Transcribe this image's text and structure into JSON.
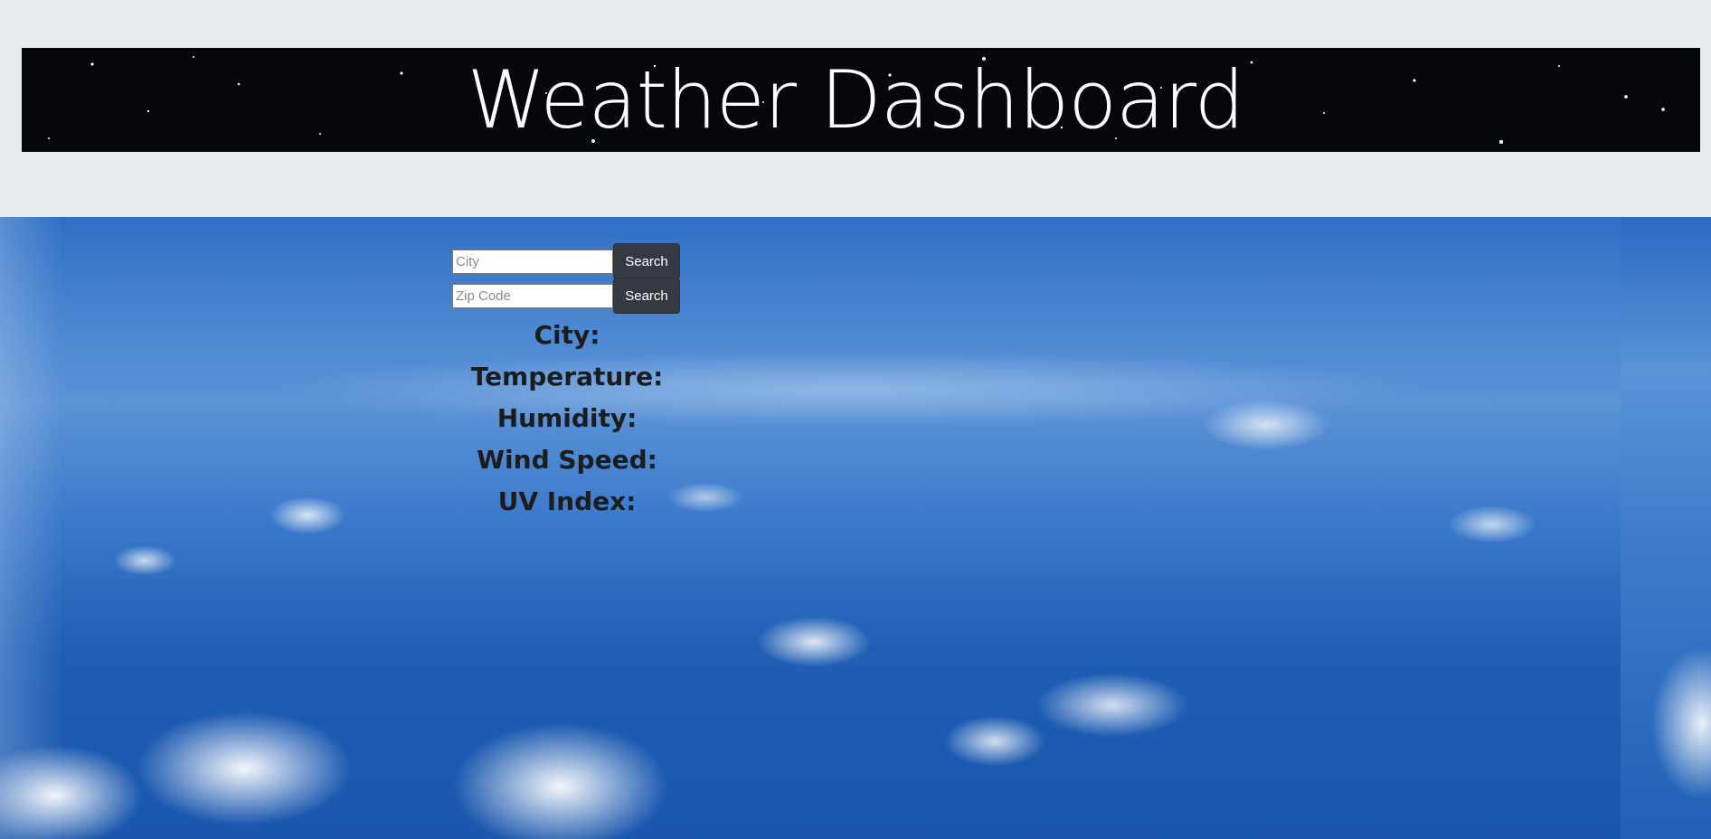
{
  "header": {
    "title": "Weather Dashboard"
  },
  "search": {
    "city_placeholder": "City",
    "city_value": "",
    "city_button_label": "Search",
    "zip_placeholder": "Zip Code",
    "zip_value": "",
    "zip_button_label": "Search"
  },
  "weather": {
    "city_label": "City:",
    "temperature_label": "Temperature:",
    "humidity_label": "Humidity:",
    "wind_speed_label": "Wind Speed:",
    "uv_index_label": "UV Index:"
  },
  "colors": {
    "page_background": "#e9ecef",
    "button_background": "#343a40",
    "button_text": "#ffffff",
    "title_text": "#ffffff",
    "info_text": "#1c1c1c"
  }
}
